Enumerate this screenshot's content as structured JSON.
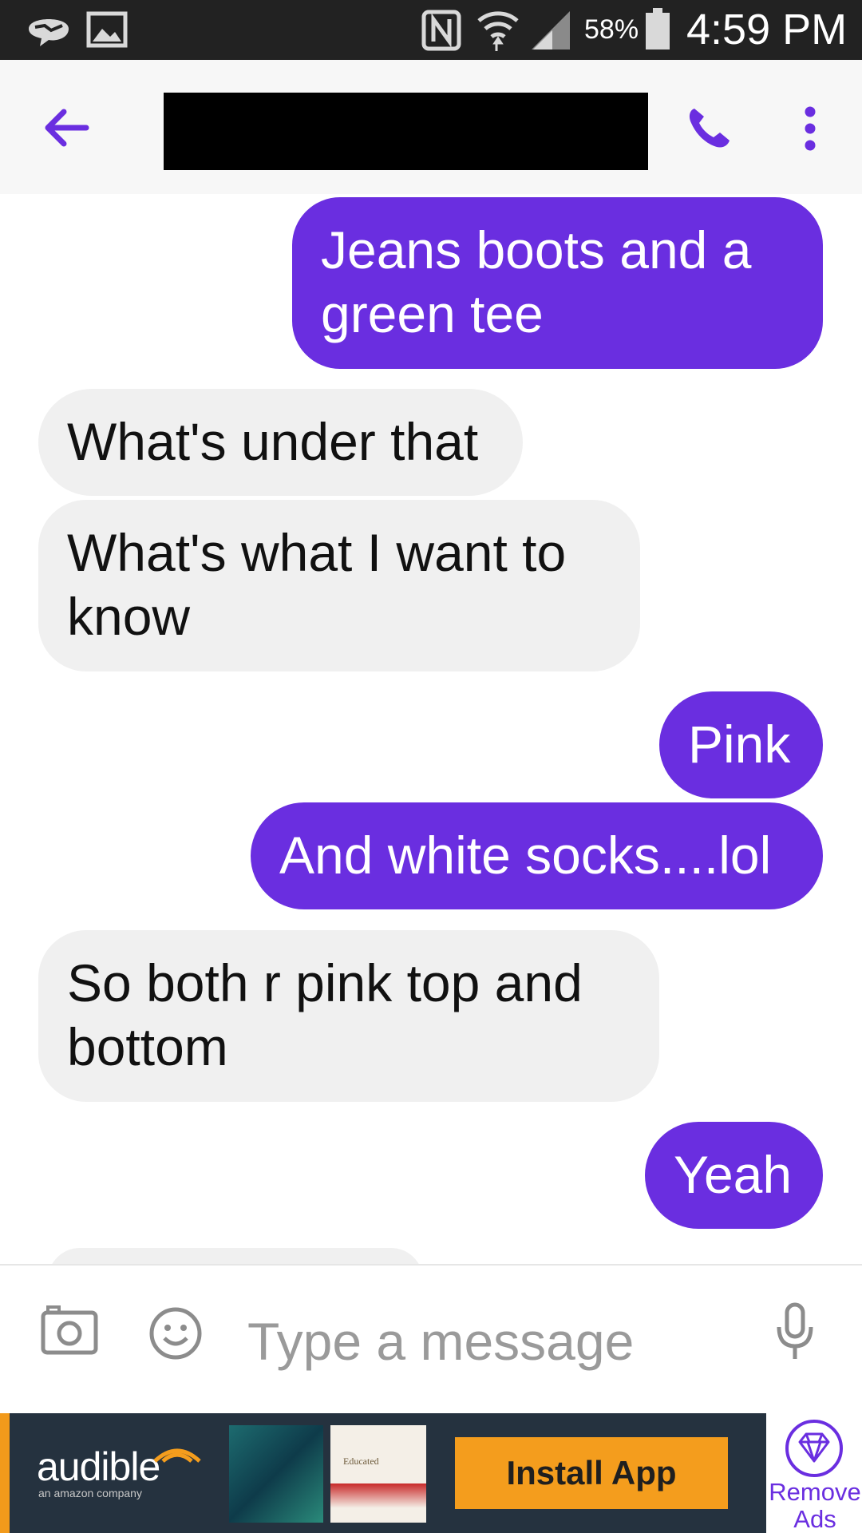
{
  "status_bar": {
    "battery_percent": "58%",
    "time": "4:59 PM",
    "icons": [
      "messenger-notification-icon",
      "image-notification-icon",
      "nfc-icon",
      "wifi-icon",
      "signal-icon",
      "battery-icon"
    ]
  },
  "header": {
    "back_icon": "back-arrow-icon",
    "call_icon": "phone-icon",
    "menu_icon": "more-vert-icon",
    "contact_name_redacted": true
  },
  "messages": [
    {
      "direction": "outgoing",
      "text": "Jeans boots and a green tee"
    },
    {
      "direction": "incoming",
      "text": "What's under that"
    },
    {
      "direction": "incoming",
      "text": "What's what I want to know"
    },
    {
      "direction": "outgoing",
      "text": "Pink"
    },
    {
      "direction": "outgoing",
      "text": "And white socks....lol"
    },
    {
      "direction": "incoming",
      "text": "So both r pink top and bottom"
    },
    {
      "direction": "outgoing",
      "text": "Yeah"
    }
  ],
  "composer": {
    "placeholder": "Type a message",
    "value": ""
  },
  "ad": {
    "brand": "audible",
    "tagline": "an amazon company",
    "book2_title": "Educated",
    "install_label": "Install App",
    "remove_ads_label": "Remove Ads"
  },
  "colors": {
    "accent": "#6a2ee0",
    "incoming_bubble": "#f0f0f0",
    "status_bar": "#222222",
    "ad_background": "#25323f",
    "install_button": "#f49d1d"
  }
}
